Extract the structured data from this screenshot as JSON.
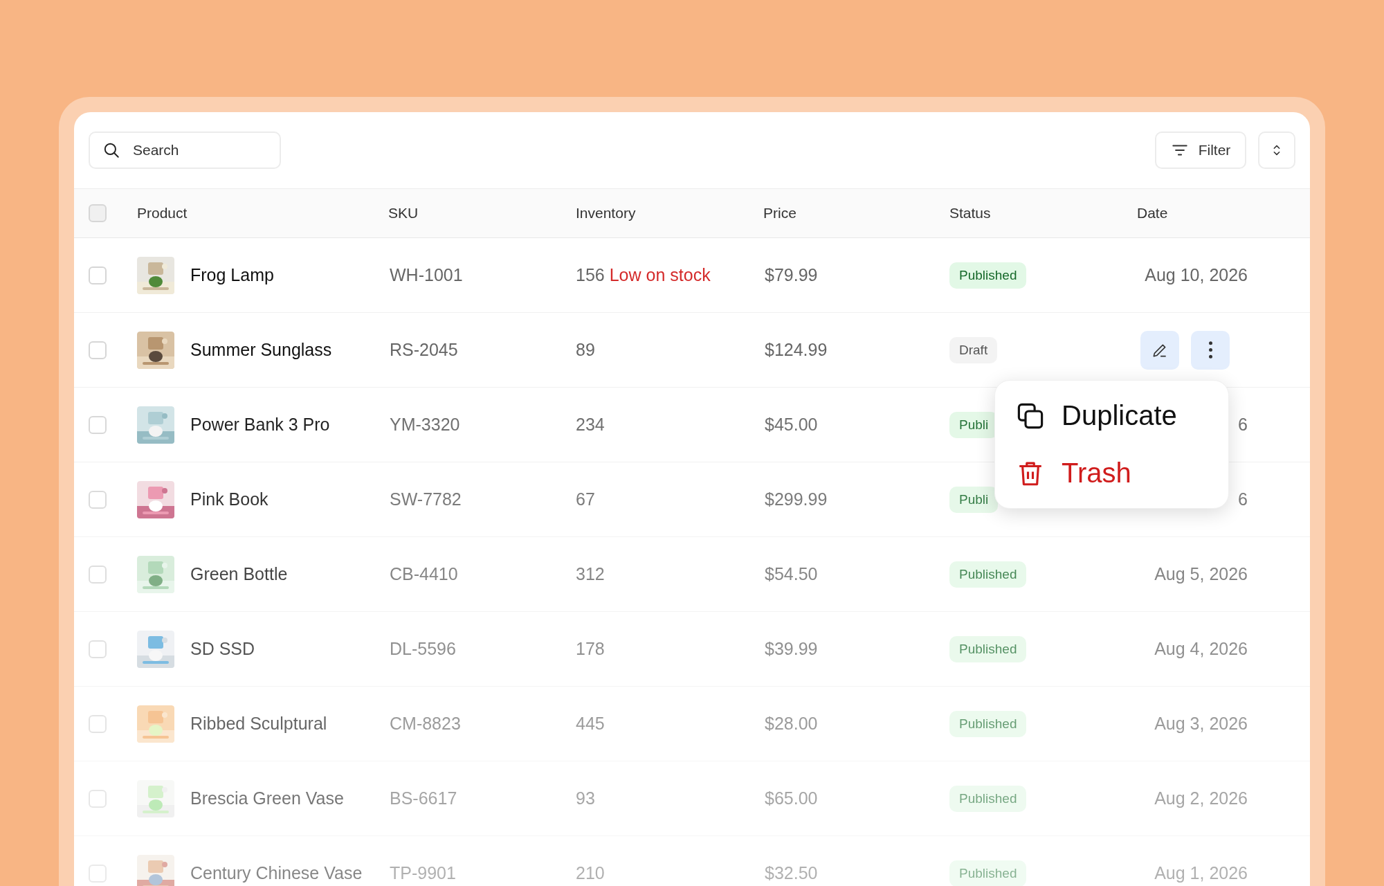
{
  "toolbar": {
    "search": {
      "placeholder": "Search"
    },
    "filter_button": "Filter"
  },
  "table": {
    "header_checkbox": {
      "checked": false
    },
    "columns": [
      "Product",
      "SKU",
      "Inventory",
      "Price",
      "Status",
      "Date"
    ],
    "rows": [
      {
        "checked": false,
        "product": "Frog Lamp",
        "sku": "WH-1001",
        "inventory": "156",
        "stock_note": "Low on stock",
        "price": "$79.99",
        "status": {
          "text": "Published",
          "kind": "published"
        },
        "date": "Aug 10, 2026",
        "hovered": false
      },
      {
        "checked": false,
        "product": "Summer Sunglass",
        "sku": "RS-2045",
        "inventory": "89",
        "price": "$124.99",
        "status": {
          "text": "Draft",
          "kind": "draft"
        },
        "hovered": true
      },
      {
        "checked": false,
        "product": "Power Bank 3 Pro",
        "sku": "YM-3320",
        "inventory": "234",
        "price": "$45.00",
        "status": {
          "text": "Publi",
          "kind": "published"
        },
        "date": "6",
        "hovered": false
      },
      {
        "checked": false,
        "product": "Pink Book",
        "sku": "SW-7782",
        "inventory": "67",
        "price": "$299.99",
        "status": {
          "text": "Publi",
          "kind": "published"
        },
        "date": "6",
        "hovered": false
      },
      {
        "checked": false,
        "product": "Green Bottle",
        "sku": "CB-4410",
        "inventory": "312",
        "price": "$54.50",
        "status": {
          "text": "Published",
          "kind": "published"
        },
        "date": "Aug 5, 2026",
        "hovered": false
      },
      {
        "checked": false,
        "product": "SD SSD",
        "sku": "DL-5596",
        "inventory": "178",
        "price": "$39.99",
        "status": {
          "text": "Published",
          "kind": "published"
        },
        "date": "Aug 4, 2026",
        "hovered": false
      },
      {
        "checked": false,
        "product": "Ribbed Sculptural",
        "sku": "CM-8823",
        "inventory": "445",
        "price": "$28.00",
        "status": {
          "text": "Published",
          "kind": "published"
        },
        "date": "Aug 3, 2026",
        "hovered": false
      },
      {
        "checked": false,
        "product": "Brescia Green Vase",
        "sku": "BS-6617",
        "inventory": "93",
        "price": "$65.00",
        "status": {
          "text": "Published",
          "kind": "published"
        },
        "date": "Aug 2, 2026",
        "hovered": false
      },
      {
        "checked": false,
        "product": "Century Chinese Vase",
        "sku": "TP-9901",
        "inventory": "210",
        "price": "$32.50",
        "status": {
          "text": "Published",
          "kind": "published"
        },
        "date": "Aug 1, 2026",
        "hovered": false
      }
    ]
  },
  "context_menu": {
    "items": [
      {
        "label": "Duplicate",
        "kind": "duplicate"
      },
      {
        "label": "Trash",
        "kind": "trash"
      }
    ]
  }
}
